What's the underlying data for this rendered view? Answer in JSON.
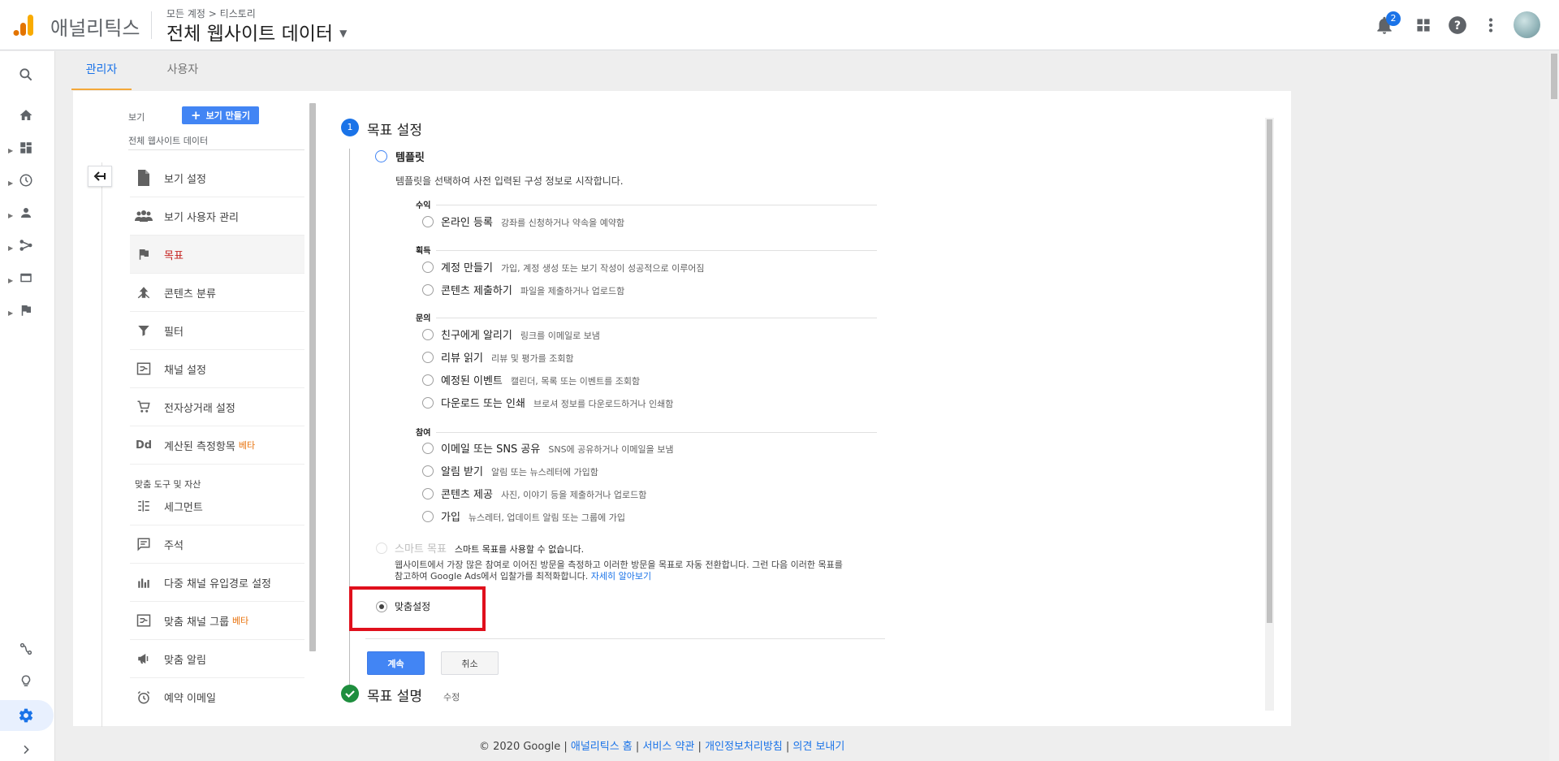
{
  "header": {
    "product_name": "애널리틱스",
    "breadcrumb": "모든 계정 > 티스토리",
    "view_title": "전체 웹사이트 데이터",
    "notification_count": "2"
  },
  "tabs": [
    {
      "label": "관리자",
      "active": true
    },
    {
      "label": "사용자",
      "active": false
    }
  ],
  "admin": {
    "view_label": "보기",
    "create_view_label": "보기 만들기",
    "view_name": "전체 웹사이트 데이터",
    "menu": [
      {
        "label": "보기 설정",
        "icon": "document-icon"
      },
      {
        "label": "보기 사용자 관리",
        "icon": "users-icon"
      },
      {
        "label": "목표",
        "icon": "flag-icon",
        "active": true
      },
      {
        "label": "콘텐츠 분류",
        "icon": "content-grouping-icon"
      },
      {
        "label": "필터",
        "icon": "filter-icon"
      },
      {
        "label": "채널 설정",
        "icon": "channel-settings-icon"
      },
      {
        "label": "전자상거래 설정",
        "icon": "cart-icon"
      },
      {
        "label": "계산된 측정항목",
        "icon": "calculated-metrics-icon",
        "beta": "베타"
      }
    ],
    "tools_section_label": "맞춤 도구 및 자산",
    "tools": [
      {
        "label": "세그먼트",
        "icon": "segments-icon"
      },
      {
        "label": "주석",
        "icon": "annotations-icon"
      },
      {
        "label": "다중 채널 유입경로 설정",
        "icon": "mcf-settings-icon"
      },
      {
        "label": "맞춤 채널 그룹",
        "icon": "custom-channel-icon",
        "beta": "베타"
      },
      {
        "label": "맞춤 알림",
        "icon": "megaphone-icon"
      },
      {
        "label": "예약 이메일",
        "icon": "alarm-icon"
      }
    ],
    "dd_text": "Dd"
  },
  "goal_setup": {
    "step1_number": "1",
    "step1_title": "목표 설정",
    "template_label": "템플릿",
    "template_desc": "템플릿을 선택하여 사전 입력된 구성 정보로 시작합니다.",
    "categories": [
      {
        "name": "수익",
        "options": [
          {
            "label": "온라인 등록",
            "desc": "강좌를 신청하거나 약속을 예약함"
          }
        ]
      },
      {
        "name": "획득",
        "options": [
          {
            "label": "계정 만들기",
            "desc": "가입, 계정 생성 또는 보기 작성이 성공적으로 이루어짐"
          },
          {
            "label": "콘텐츠 제출하기",
            "desc": "파일을 제출하거나 업로드함"
          }
        ]
      },
      {
        "name": "문의",
        "options": [
          {
            "label": "친구에게 알리기",
            "desc": "링크를 이메일로 보냄"
          },
          {
            "label": "리뷰 읽기",
            "desc": "리뷰 및 평가를 조회함"
          },
          {
            "label": "예정된 이벤트",
            "desc": "캘린더, 목록 또는 이벤트를 조회함"
          },
          {
            "label": "다운로드 또는 인쇄",
            "desc": "브로셔 정보를 다운로드하거나 인쇄함"
          }
        ]
      },
      {
        "name": "참여",
        "options": [
          {
            "label": "이메일 또는 SNS 공유",
            "desc": "SNS에 공유하거나 이메일을 보냄"
          },
          {
            "label": "알림 받기",
            "desc": "알림 또는 뉴스레터에 가입함"
          },
          {
            "label": "콘텐츠 제공",
            "desc": "사진, 이야기 등을 제출하거나 업로드함"
          },
          {
            "label": "가입",
            "desc": "뉴스레터, 업데이트 알림 또는 그룹에 가입"
          }
        ]
      }
    ],
    "smart_goal_label": "스마트 목표",
    "smart_goal_note": "스마트 목표를 사용할 수 없습니다.",
    "smart_goal_desc_line1": "웹사이트에서 가장 많은 참여로 이어진 방문을 측정하고 이러한 방문을 목표로 자동 전환합니다. 그런 다음 이러한 목표를",
    "smart_goal_desc_line2": "참고하여 Google Ads에서 입찰가를 최적화합니다.",
    "learn_more": "자세히 알아보기",
    "custom_label": "맞춤설정",
    "continue_label": "계속",
    "cancel_label": "취소",
    "step2_title": "목표 설명",
    "step2_edit": "수정"
  },
  "footer": {
    "copyright": "© 2020 Google",
    "links": [
      "애널리틱스 홈",
      "서비스 약관",
      "개인정보처리방침",
      "의견 보내기"
    ]
  },
  "colors": {
    "accent": "#1a73e8",
    "button_blue": "#4285f4",
    "active_red": "#c5221f",
    "highlight_red": "#e0101c",
    "beta_orange": "#e8710a",
    "tab_underline": "#f4a83a",
    "check_green": "#1e8e3e"
  }
}
